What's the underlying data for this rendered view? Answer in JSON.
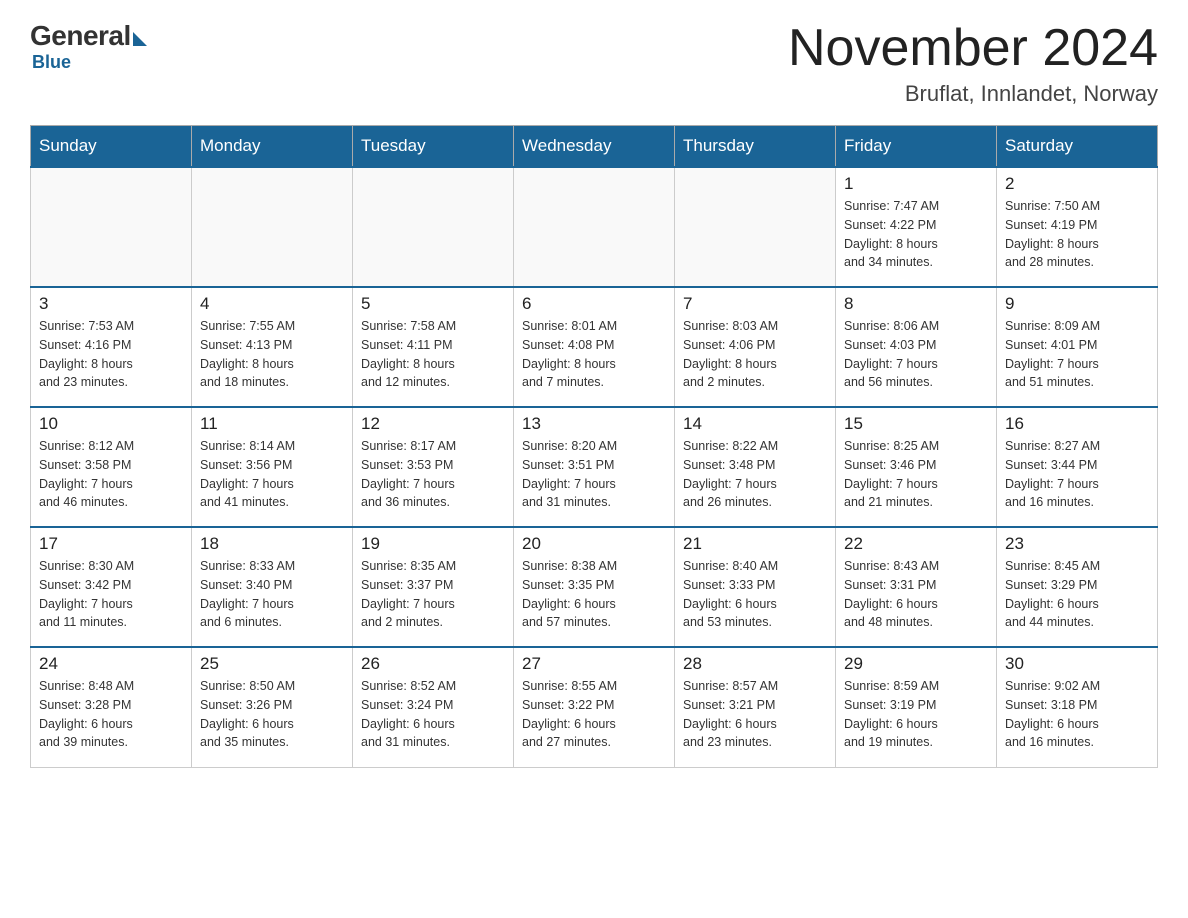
{
  "header": {
    "logo": {
      "general": "General",
      "blue": "Blue"
    },
    "title": "November 2024",
    "location": "Bruflat, Innlandet, Norway"
  },
  "days_of_week": [
    "Sunday",
    "Monday",
    "Tuesday",
    "Wednesday",
    "Thursday",
    "Friday",
    "Saturday"
  ],
  "weeks": [
    [
      {
        "day": "",
        "info": ""
      },
      {
        "day": "",
        "info": ""
      },
      {
        "day": "",
        "info": ""
      },
      {
        "day": "",
        "info": ""
      },
      {
        "day": "",
        "info": ""
      },
      {
        "day": "1",
        "info": "Sunrise: 7:47 AM\nSunset: 4:22 PM\nDaylight: 8 hours\nand 34 minutes."
      },
      {
        "day": "2",
        "info": "Sunrise: 7:50 AM\nSunset: 4:19 PM\nDaylight: 8 hours\nand 28 minutes."
      }
    ],
    [
      {
        "day": "3",
        "info": "Sunrise: 7:53 AM\nSunset: 4:16 PM\nDaylight: 8 hours\nand 23 minutes."
      },
      {
        "day": "4",
        "info": "Sunrise: 7:55 AM\nSunset: 4:13 PM\nDaylight: 8 hours\nand 18 minutes."
      },
      {
        "day": "5",
        "info": "Sunrise: 7:58 AM\nSunset: 4:11 PM\nDaylight: 8 hours\nand 12 minutes."
      },
      {
        "day": "6",
        "info": "Sunrise: 8:01 AM\nSunset: 4:08 PM\nDaylight: 8 hours\nand 7 minutes."
      },
      {
        "day": "7",
        "info": "Sunrise: 8:03 AM\nSunset: 4:06 PM\nDaylight: 8 hours\nand 2 minutes."
      },
      {
        "day": "8",
        "info": "Sunrise: 8:06 AM\nSunset: 4:03 PM\nDaylight: 7 hours\nand 56 minutes."
      },
      {
        "day": "9",
        "info": "Sunrise: 8:09 AM\nSunset: 4:01 PM\nDaylight: 7 hours\nand 51 minutes."
      }
    ],
    [
      {
        "day": "10",
        "info": "Sunrise: 8:12 AM\nSunset: 3:58 PM\nDaylight: 7 hours\nand 46 minutes."
      },
      {
        "day": "11",
        "info": "Sunrise: 8:14 AM\nSunset: 3:56 PM\nDaylight: 7 hours\nand 41 minutes."
      },
      {
        "day": "12",
        "info": "Sunrise: 8:17 AM\nSunset: 3:53 PM\nDaylight: 7 hours\nand 36 minutes."
      },
      {
        "day": "13",
        "info": "Sunrise: 8:20 AM\nSunset: 3:51 PM\nDaylight: 7 hours\nand 31 minutes."
      },
      {
        "day": "14",
        "info": "Sunrise: 8:22 AM\nSunset: 3:48 PM\nDaylight: 7 hours\nand 26 minutes."
      },
      {
        "day": "15",
        "info": "Sunrise: 8:25 AM\nSunset: 3:46 PM\nDaylight: 7 hours\nand 21 minutes."
      },
      {
        "day": "16",
        "info": "Sunrise: 8:27 AM\nSunset: 3:44 PM\nDaylight: 7 hours\nand 16 minutes."
      }
    ],
    [
      {
        "day": "17",
        "info": "Sunrise: 8:30 AM\nSunset: 3:42 PM\nDaylight: 7 hours\nand 11 minutes."
      },
      {
        "day": "18",
        "info": "Sunrise: 8:33 AM\nSunset: 3:40 PM\nDaylight: 7 hours\nand 6 minutes."
      },
      {
        "day": "19",
        "info": "Sunrise: 8:35 AM\nSunset: 3:37 PM\nDaylight: 7 hours\nand 2 minutes."
      },
      {
        "day": "20",
        "info": "Sunrise: 8:38 AM\nSunset: 3:35 PM\nDaylight: 6 hours\nand 57 minutes."
      },
      {
        "day": "21",
        "info": "Sunrise: 8:40 AM\nSunset: 3:33 PM\nDaylight: 6 hours\nand 53 minutes."
      },
      {
        "day": "22",
        "info": "Sunrise: 8:43 AM\nSunset: 3:31 PM\nDaylight: 6 hours\nand 48 minutes."
      },
      {
        "day": "23",
        "info": "Sunrise: 8:45 AM\nSunset: 3:29 PM\nDaylight: 6 hours\nand 44 minutes."
      }
    ],
    [
      {
        "day": "24",
        "info": "Sunrise: 8:48 AM\nSunset: 3:28 PM\nDaylight: 6 hours\nand 39 minutes."
      },
      {
        "day": "25",
        "info": "Sunrise: 8:50 AM\nSunset: 3:26 PM\nDaylight: 6 hours\nand 35 minutes."
      },
      {
        "day": "26",
        "info": "Sunrise: 8:52 AM\nSunset: 3:24 PM\nDaylight: 6 hours\nand 31 minutes."
      },
      {
        "day": "27",
        "info": "Sunrise: 8:55 AM\nSunset: 3:22 PM\nDaylight: 6 hours\nand 27 minutes."
      },
      {
        "day": "28",
        "info": "Sunrise: 8:57 AM\nSunset: 3:21 PM\nDaylight: 6 hours\nand 23 minutes."
      },
      {
        "day": "29",
        "info": "Sunrise: 8:59 AM\nSunset: 3:19 PM\nDaylight: 6 hours\nand 19 minutes."
      },
      {
        "day": "30",
        "info": "Sunrise: 9:02 AM\nSunset: 3:18 PM\nDaylight: 6 hours\nand 16 minutes."
      }
    ]
  ]
}
